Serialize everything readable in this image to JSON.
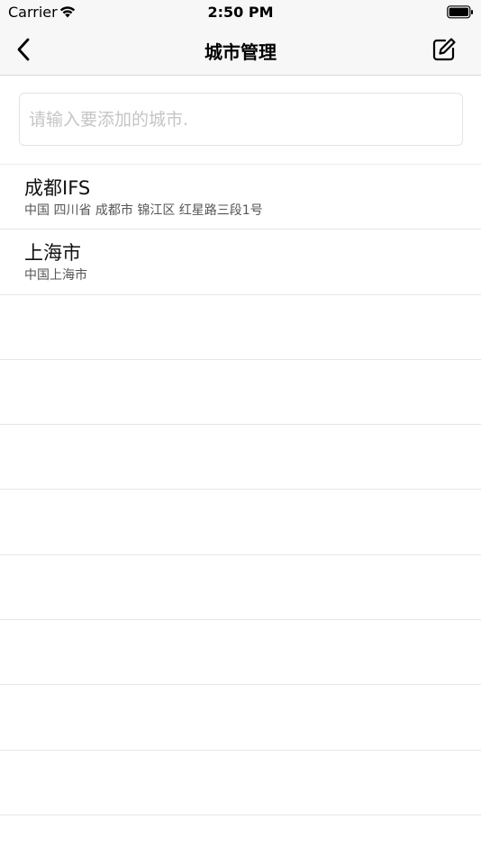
{
  "status_bar": {
    "carrier": "Carrier",
    "time": "2:50 PM"
  },
  "nav": {
    "title": "城市管理",
    "back_icon": "chevron-left-icon",
    "edit_icon": "edit-icon"
  },
  "search": {
    "placeholder": "请输入要添加的城市.",
    "value": ""
  },
  "cities": [
    {
      "name": "成都IFS",
      "address": "中国 四川省 成都市 锦江区 红星路三段1号"
    },
    {
      "name": "上海市",
      "address": "中国上海市"
    }
  ],
  "colors": {
    "bar_background": "#f7f7f7",
    "separator": "#e6e6e6",
    "placeholder": "#c5c5c5"
  }
}
